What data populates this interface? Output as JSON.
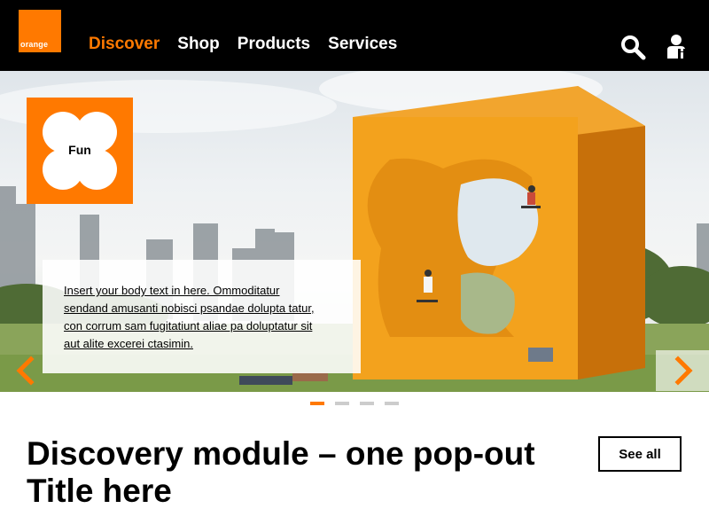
{
  "header": {
    "logo_text": "orange",
    "nav": [
      {
        "label": "Discover",
        "active": true
      },
      {
        "label": "Shop",
        "active": false
      },
      {
        "label": "Products",
        "active": false
      },
      {
        "label": "Services",
        "active": false
      }
    ],
    "icons": [
      "search-icon",
      "user-icon"
    ]
  },
  "hero": {
    "tile_label": "Fun",
    "body_text": "Insert your body text in here. Ommoditatur sendand amusanti nobisci psandae dolupta tatur, con corrum sam fugitatiunt aliae pa doluptatur sit aut alite excerei ctasimin.",
    "prev_icon": "chevron-left-icon",
    "next_icon": "chevron-right-icon"
  },
  "carousel": {
    "slides": 4,
    "active_index": 0
  },
  "module": {
    "title": "Discovery module – one pop-out Title here",
    "see_all_label": "See all"
  },
  "colors": {
    "brand": "#ff7900",
    "header_bg": "#000000",
    "dot_inactive": "#cccccc"
  }
}
